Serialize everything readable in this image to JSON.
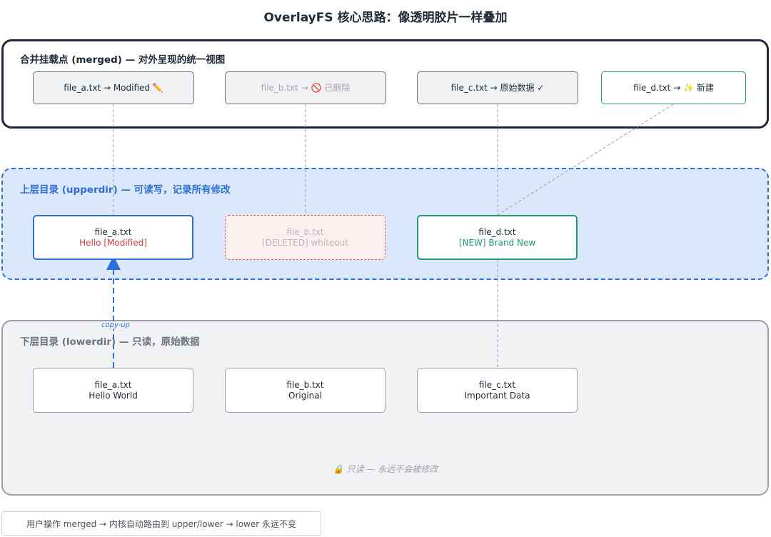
{
  "title": "OverlayFS 核心思路：像透明胶片一样叠加",
  "merged": {
    "label": "合并挂载点 (merged) — 对外呈现的统一视图",
    "files": [
      {
        "text": "file_a.txt → Modified",
        "icon": "pencil-icon",
        "glyph": "✏️"
      },
      {
        "text": "file_b.txt → ",
        "icon": "prohibited-icon",
        "glyph": "🚫",
        "suffix": " 已删除"
      },
      {
        "text": "file_c.txt → 原始数据 ✓"
      },
      {
        "text": "file_d.txt → ",
        "icon": "sparkles-icon",
        "glyph": "✨",
        "suffix": " 新建"
      }
    ]
  },
  "upper": {
    "label": "上层目录 (upperdir) — 可读写，记录所有修改",
    "files": [
      {
        "name": "file_a.txt",
        "content": "Hello [Modified]"
      },
      {
        "name": "file_b.txt",
        "content": "[DELETED] whiteout"
      },
      {
        "name": "file_d.txt",
        "content": "[NEW] Brand New"
      }
    ]
  },
  "lower": {
    "label": "下层目录 (lowerdir) — 只读，原始数据",
    "files": [
      {
        "name": "file_a.txt",
        "content": "Hello World"
      },
      {
        "name": "file_b.txt",
        "content": "Original"
      },
      {
        "name": "file_c.txt",
        "content": "Important Data"
      }
    ],
    "note_icon": "lock-icon",
    "note_glyph": "🔒",
    "note": "只读 — 永远不会被修改"
  },
  "copy_up_label": "copy-up",
  "footer": "用户操作 merged → 内核自动路由到 upper/lower → lower 永远不变",
  "colors": {
    "upper_accent": "#2f6fd6",
    "new_accent": "#1f9a6b",
    "deleted_accent": "#e05a5a"
  }
}
